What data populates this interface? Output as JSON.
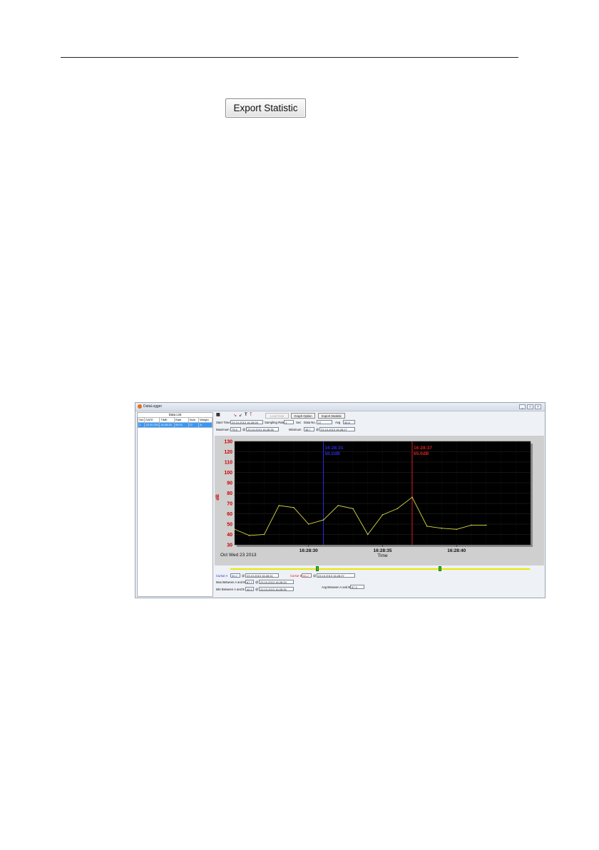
{
  "page": {
    "export_button_label": "Export Statistic"
  },
  "window": {
    "title": "DataLogger",
    "controls": [
      "_",
      "□",
      "×"
    ],
    "datalist": {
      "title": "Data List",
      "headers": [
        "Set",
        "DATE",
        "TIME",
        "Rate",
        "Num",
        "Weight"
      ],
      "rows": [
        [
          "1",
          "23.10.2013",
          "16:28:28",
          "00:01",
          "17",
          "A"
        ]
      ]
    },
    "toolbar": {
      "tool_icons": [
        "cursor-a-icon",
        "cursor-b-icon",
        "text-t-icon",
        "text-t-red-icon"
      ],
      "load_data": "Load Data",
      "graph_option": "Graph Option",
      "export_statistic": "Export Statistic"
    },
    "info": {
      "start_time_label": "Start Time",
      "start_time": "23.10.2013 16:28:28",
      "sampling_rate_label": "Sampling Rate",
      "sampling_rate": "1",
      "sec": "Sec",
      "data_no_label": "Data No.",
      "data_no": "17",
      "avg_label": "Avg",
      "avg": "54.6",
      "maximum_label": "Maximum",
      "maximum": "75.6",
      "maximum_at": "23.10.2013 16:28:38",
      "minimum_label": "Minimum",
      "minimum": "38.7",
      "minimum_at": "23.10.2013 16:28:27",
      "at": "@"
    },
    "cursors": {
      "a_label": "Cursor A",
      "a_value": "50.2",
      "a_time": "23.10.2013 16:28:31",
      "b_label": "Cursor B",
      "b_value": "65.2",
      "b_time": "23.10.2013 16:28:37",
      "max_ab_label": "Max Between A and B",
      "max_ab": "67.7",
      "max_ab_time": "23.10.2013 16:28:33",
      "min_ab_label": "Min Between A and B",
      "min_ab": "40.1",
      "min_ab_time": "23.10.2013 16:28:35",
      "avg_ab_label": "Avg Between A and B",
      "avg_ab": "57.3"
    },
    "slider": {
      "thumb_a_position": 0.29,
      "thumb_b_position": 0.7
    }
  },
  "chart_data": {
    "type": "line",
    "ylabel": "dB",
    "xlabel": "Time",
    "date_text": "Oct Wed 23 2013",
    "ylim": [
      30,
      130
    ],
    "yticks": [
      30,
      40,
      50,
      60,
      70,
      80,
      90,
      100,
      110,
      120,
      130
    ],
    "xlim": [
      0,
      20
    ],
    "xticks": [
      {
        "x": 5,
        "label": "16:28:30"
      },
      {
        "x": 10,
        "label": "16:28:35"
      },
      {
        "x": 15,
        "label": "16:28:40"
      }
    ],
    "x": [
      0,
      1,
      2,
      3,
      4,
      5,
      6,
      7,
      8,
      9,
      10,
      11,
      12,
      13,
      14,
      15,
      16,
      17
    ],
    "series": [
      {
        "values": [
          45,
          39,
          40,
          68,
          66,
          50,
          54,
          68,
          65,
          40,
          59,
          65,
          76,
          48,
          46,
          45,
          49,
          49
        ],
        "color": "#d8d840"
      }
    ],
    "cursor_a": {
      "x": 6,
      "time": "16:28:31",
      "value": "50.2dB",
      "color": "#2a2ad8"
    },
    "cursor_b": {
      "x": 12,
      "time": "16:28:37",
      "value": "65.0dB",
      "color": "#d82020"
    },
    "tick_color": "#cc0000",
    "grid": true,
    "background": "#000000"
  }
}
